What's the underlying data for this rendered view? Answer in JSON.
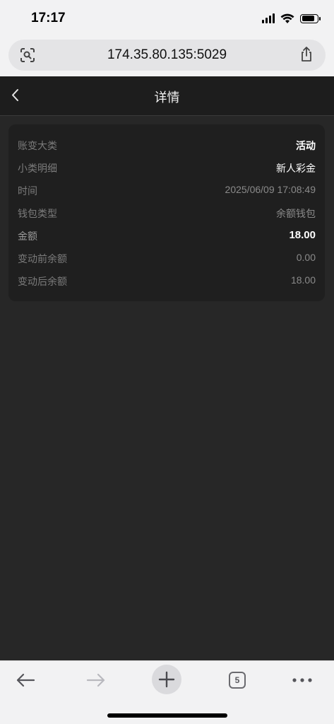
{
  "status_bar": {
    "time": "17:17"
  },
  "browser": {
    "url": "174.35.80.135:5029"
  },
  "header": {
    "title": "详情"
  },
  "details": [
    {
      "label": "账变大类",
      "value": "活动",
      "style": "strong"
    },
    {
      "label": "小类明细",
      "value": "新人彩金",
      "style": "white"
    },
    {
      "label": "时间",
      "value": "2025/06/09 17:08:49",
      "style": "muted"
    },
    {
      "label": "钱包类型",
      "value": "余额钱包",
      "style": "muted"
    },
    {
      "label": "金额",
      "value": "18.00",
      "style": "strong-amount"
    },
    {
      "label": "变动前余额",
      "value": "0.00",
      "style": "muted"
    },
    {
      "label": "变动后余额",
      "value": "18.00",
      "style": "muted"
    }
  ],
  "toolbar": {
    "tab_count": "5"
  }
}
